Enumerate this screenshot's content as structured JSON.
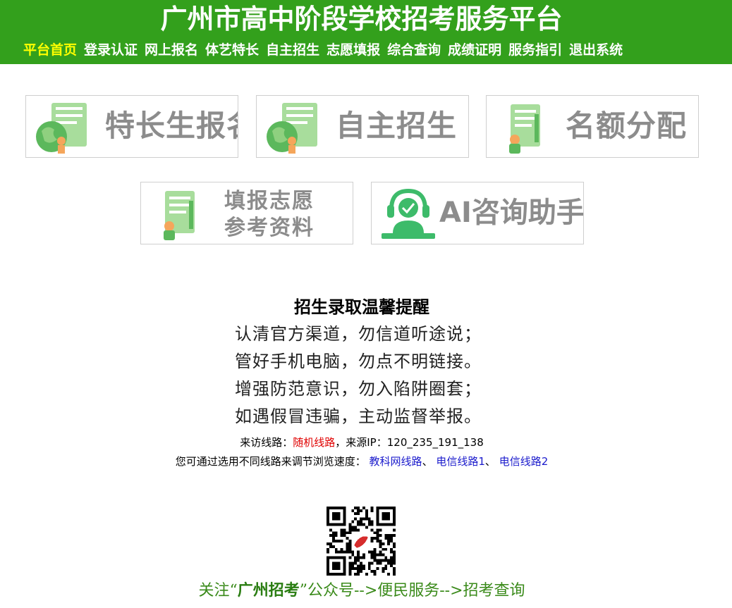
{
  "header": {
    "title": "广州市高中阶段学校招考服务平台",
    "nav": [
      {
        "label": "平台首页",
        "active": true
      },
      {
        "label": "登录认证"
      },
      {
        "label": "网上报名"
      },
      {
        "label": "体艺特长"
      },
      {
        "label": "自主招生"
      },
      {
        "label": "志愿填报"
      },
      {
        "label": "综合查询"
      },
      {
        "label": "成绩证明"
      },
      {
        "label": "服务指引"
      },
      {
        "label": "退出系统"
      }
    ]
  },
  "tiles": {
    "talent": "特长生报名",
    "self": "自主招生",
    "quota": "名额分配",
    "ref_line1": "填报志愿",
    "ref_line2": "参考资料",
    "ai": "AI咨询助手"
  },
  "notice": {
    "title": "招生录取温馨提醒",
    "lines": [
      "认清官方渠道，勿信道听途说；",
      "管好手机电脑，勿点不明链接。",
      "增强防范意识，勿入陷阱圈套；",
      "如遇假冒违骗，主动监督举报。"
    ]
  },
  "route": {
    "prefix": "来访线路：",
    "current": "随机线路",
    "ip_label": "，来源IP：",
    "ip": "120_235_191_138"
  },
  "speed": {
    "prefix": "您可通过选用不同线路来调节浏览速度：",
    "links": [
      "教科网线路",
      "电信线路1",
      "电信线路2"
    ],
    "sep": "、"
  },
  "follow": {
    "pre": "关注“",
    "account": "广州招考",
    "post": "”公众号-->便民服务-->招考查询"
  },
  "colors": {
    "header_bg": "#33a01c",
    "nav_active": "#ffff00",
    "link": "#1a1acc",
    "route_current": "#e00000",
    "tile_text": "#8c8c8c",
    "icon_green": "#7ccf72"
  }
}
